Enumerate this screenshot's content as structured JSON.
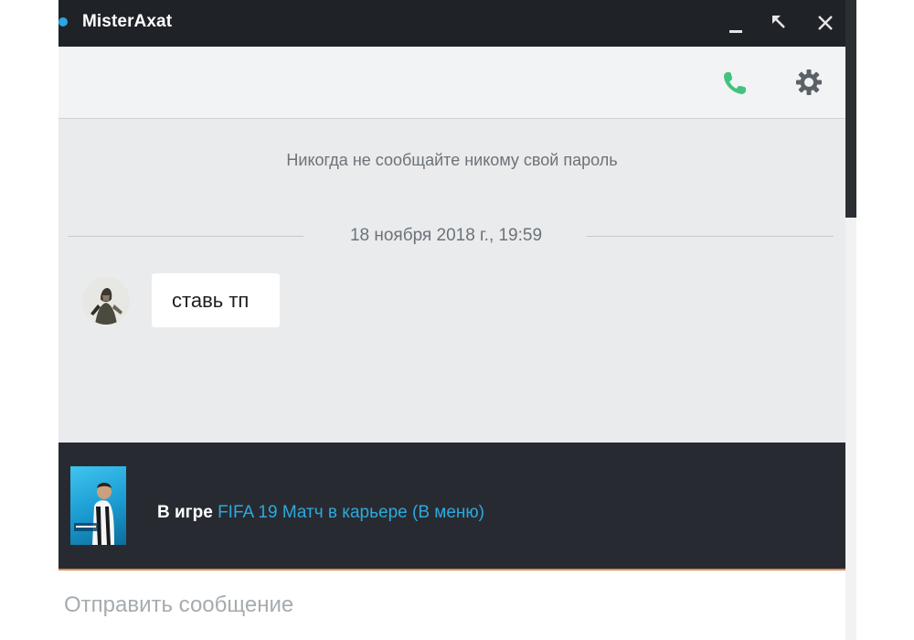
{
  "window": {
    "title": "MisterAxat",
    "status_color": "#2aa6e6",
    "controls": [
      "minimize",
      "restore",
      "close"
    ]
  },
  "toolbar": {
    "call_icon": "phone-icon",
    "call_color": "#41c37f",
    "settings_icon": "gear-icon"
  },
  "chat": {
    "warning": "Никогда не сообщайте никому свой пароль",
    "date_separator": "18 ноября 2018 г., 19:59",
    "messages": [
      {
        "author_avatar": "avatar",
        "text": "ставь тп"
      }
    ]
  },
  "game_status": {
    "prefix": "В игре",
    "game": "FIFA 19 Матч в карьере (В меню)",
    "link_color": "#2fa8dd"
  },
  "composer": {
    "placeholder": "Отправить сообщение",
    "value": "",
    "accent_color": "#e08b57"
  }
}
